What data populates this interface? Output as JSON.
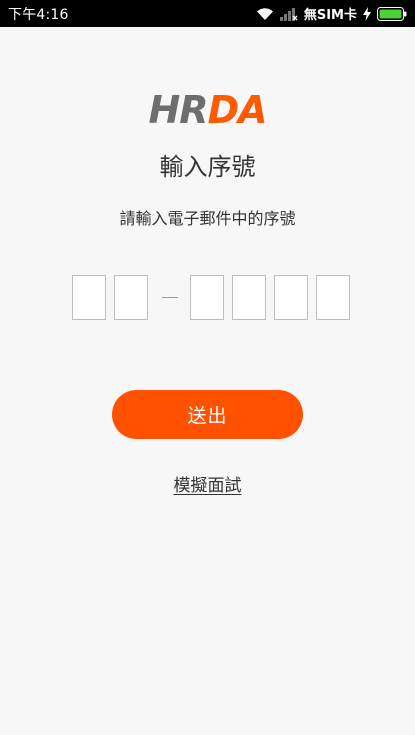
{
  "status_bar": {
    "time": "下午4:16",
    "carrier": "無SIM卡",
    "icons": [
      "wifi-icon",
      "signal-icon",
      "charging-icon",
      "battery-icon"
    ],
    "battery_color": "#4cd137"
  },
  "logo": {
    "part1": "HR",
    "part2": "DA",
    "color1": "#6e6e6e",
    "color2": "#ff5a00"
  },
  "page": {
    "title": "輸入序號",
    "subtitle": "請輸入電子郵件中的序號"
  },
  "serial": {
    "group1_count": 2,
    "group2_count": 4,
    "values": [
      "",
      "",
      "",
      "",
      "",
      ""
    ]
  },
  "actions": {
    "submit_label": "送出",
    "submit_color": "#ff5100",
    "mock_interview_label": "模擬面試"
  }
}
